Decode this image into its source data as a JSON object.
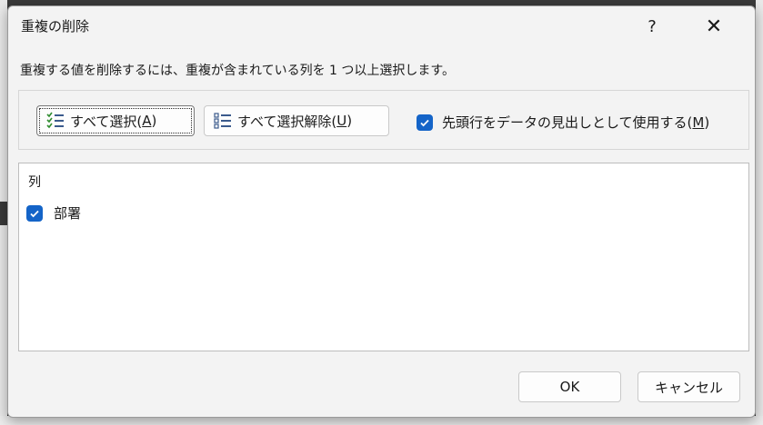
{
  "dialog": {
    "title": "重複の削除",
    "help_symbol": "?",
    "close_symbol": "✕",
    "instruction": "重複する値を削除するには、重複が含まれている列を 1 つ以上選択します。"
  },
  "toolbar": {
    "select_all_label": "すべて選択(",
    "select_all_key": "A",
    "select_all_suffix": ")",
    "deselect_all_label": "すべて選択解除(",
    "deselect_all_key": "U",
    "deselect_all_suffix": ")",
    "has_headers_label": "先頭行をデータの見出しとして使用する(",
    "has_headers_key": "M",
    "has_headers_suffix": ")",
    "has_headers_checked": true
  },
  "columns": {
    "header": "列",
    "items": [
      {
        "label": "部署",
        "checked": true
      }
    ]
  },
  "buttons": {
    "ok_label": "OK",
    "cancel_label": "キャンセル"
  },
  "colors": {
    "accent": "#1464c8",
    "dialog_bg": "#f3f3f3"
  },
  "icons": [
    "select-all-icon",
    "deselect-all-icon",
    "help-icon",
    "close-icon",
    "checkmark-icon"
  ]
}
